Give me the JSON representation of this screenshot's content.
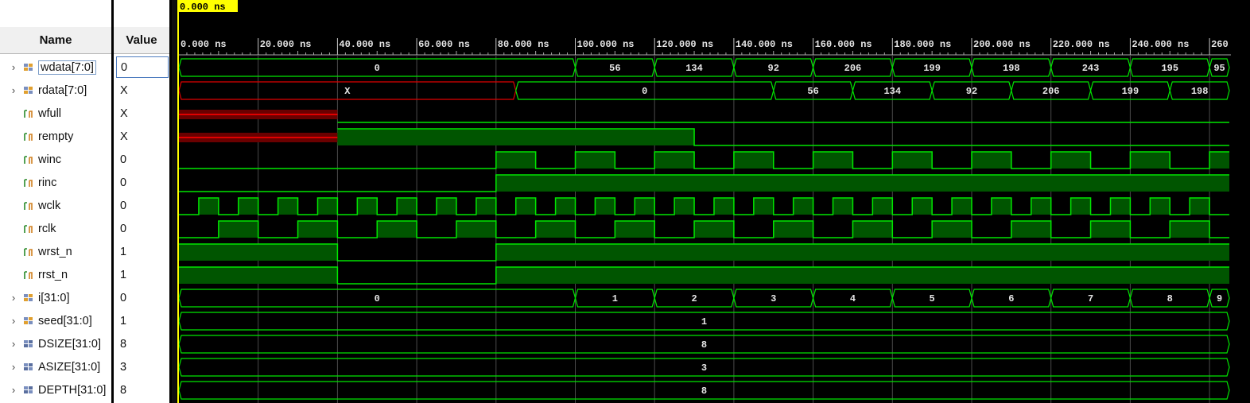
{
  "columns": {
    "name": "Name",
    "value": "Value"
  },
  "cursor_time": "0.000 ns",
  "timeline": {
    "ticks": [
      "0.000 ns",
      "20.000 ns",
      "40.000 ns",
      "60.000 ns",
      "80.000 ns",
      "100.000 ns",
      "120.000 ns",
      "140.000 ns",
      "160.000 ns",
      "180.000 ns",
      "200.000 ns",
      "220.000 ns",
      "240.000 ns",
      "260"
    ],
    "tick_times_ns": [
      0,
      20,
      40,
      60,
      80,
      100,
      120,
      140,
      160,
      180,
      200,
      220,
      240,
      260
    ]
  },
  "colors": {
    "wave": "#00e600",
    "fill": "#005500",
    "undefined": "#e00000",
    "undefined_fill": "#6a0000",
    "cursor": "#ffff00",
    "background": "#000000"
  },
  "signals": [
    {
      "name": "wdata[7:0]",
      "value": "0",
      "kind": "bus",
      "icon": "bus-icon",
      "expandable": true,
      "selected": true,
      "segments": [
        [
          0,
          100,
          "0"
        ],
        [
          100,
          120,
          "56"
        ],
        [
          120,
          140,
          "134"
        ],
        [
          140,
          160,
          "92"
        ],
        [
          160,
          180,
          "206"
        ],
        [
          180,
          200,
          "199"
        ],
        [
          200,
          220,
          "198"
        ],
        [
          220,
          240,
          "243"
        ],
        [
          240,
          260,
          "195"
        ],
        [
          260,
          265,
          "95"
        ]
      ]
    },
    {
      "name": "rdata[7:0]",
      "value": "X",
      "kind": "bus",
      "icon": "bus-icon",
      "expandable": true,
      "segments": [
        [
          0,
          85,
          "X",
          "x"
        ],
        [
          85,
          150,
          "0"
        ],
        [
          150,
          170,
          "56"
        ],
        [
          170,
          190,
          "134"
        ],
        [
          190,
          210,
          "92"
        ],
        [
          210,
          230,
          "206"
        ],
        [
          230,
          250,
          "199"
        ],
        [
          250,
          265,
          "198"
        ]
      ]
    },
    {
      "name": "wfull",
      "value": "X",
      "kind": "bit",
      "icon": "bit-icon",
      "segments": [
        [
          0,
          40,
          "x"
        ],
        [
          40,
          265,
          "0"
        ]
      ]
    },
    {
      "name": "rempty",
      "value": "X",
      "kind": "bit",
      "icon": "bit-icon",
      "segments": [
        [
          0,
          40,
          "x"
        ],
        [
          40,
          130,
          "1"
        ],
        [
          130,
          265,
          "0"
        ]
      ]
    },
    {
      "name": "winc",
      "value": "0",
      "kind": "bit",
      "icon": "bit-icon",
      "segments": [
        [
          0,
          80,
          "0"
        ],
        [
          80,
          90,
          "1"
        ],
        [
          90,
          100,
          "0"
        ],
        [
          100,
          110,
          "1"
        ],
        [
          110,
          120,
          "0"
        ],
        [
          120,
          130,
          "1"
        ],
        [
          130,
          140,
          "0"
        ],
        [
          140,
          150,
          "1"
        ],
        [
          150,
          160,
          "0"
        ],
        [
          160,
          170,
          "1"
        ],
        [
          170,
          180,
          "0"
        ],
        [
          180,
          190,
          "1"
        ],
        [
          190,
          200,
          "0"
        ],
        [
          200,
          210,
          "1"
        ],
        [
          210,
          220,
          "0"
        ],
        [
          220,
          230,
          "1"
        ],
        [
          230,
          240,
          "0"
        ],
        [
          240,
          250,
          "1"
        ],
        [
          250,
          260,
          "0"
        ],
        [
          260,
          265,
          "1"
        ]
      ]
    },
    {
      "name": "rinc",
      "value": "0",
      "kind": "bit",
      "icon": "bit-icon",
      "segments": [
        [
          0,
          80,
          "0"
        ],
        [
          80,
          265,
          "1"
        ]
      ]
    },
    {
      "name": "wclk",
      "value": "0",
      "kind": "clock",
      "icon": "bit-icon",
      "period_ns": 10,
      "high_offset_ns": 5
    },
    {
      "name": "rclk",
      "value": "0",
      "kind": "clock",
      "icon": "bit-icon",
      "period_ns": 20,
      "high_offset_ns": 10
    },
    {
      "name": "wrst_n",
      "value": "1",
      "kind": "bit",
      "icon": "bit-icon",
      "segments": [
        [
          0,
          40,
          "1"
        ],
        [
          40,
          80,
          "0"
        ],
        [
          80,
          265,
          "1"
        ]
      ]
    },
    {
      "name": "rrst_n",
      "value": "1",
      "kind": "bit",
      "icon": "bit-icon",
      "segments": [
        [
          0,
          40,
          "1"
        ],
        [
          40,
          80,
          "0"
        ],
        [
          80,
          265,
          "1"
        ]
      ]
    },
    {
      "name": "i[31:0]",
      "value": "0",
      "kind": "bus",
      "icon": "bus-icon",
      "expandable": true,
      "segments": [
        [
          0,
          100,
          "0"
        ],
        [
          100,
          120,
          "1"
        ],
        [
          120,
          140,
          "2"
        ],
        [
          140,
          160,
          "3"
        ],
        [
          160,
          180,
          "4"
        ],
        [
          180,
          200,
          "5"
        ],
        [
          200,
          220,
          "6"
        ],
        [
          220,
          240,
          "7"
        ],
        [
          240,
          260,
          "8"
        ],
        [
          260,
          265,
          "9"
        ]
      ]
    },
    {
      "name": "seed[31:0]",
      "value": "1",
      "kind": "bus",
      "icon": "bus-icon",
      "expandable": true,
      "segments": [
        [
          0,
          265,
          "1"
        ]
      ]
    },
    {
      "name": "DSIZE[31:0]",
      "value": "8",
      "kind": "bus",
      "icon": "param-icon",
      "expandable": true,
      "segments": [
        [
          0,
          265,
          "8"
        ]
      ]
    },
    {
      "name": "ASIZE[31:0]",
      "value": "3",
      "kind": "bus",
      "icon": "param-icon",
      "expandable": true,
      "segments": [
        [
          0,
          265,
          "3"
        ]
      ]
    },
    {
      "name": "DEPTH[31:0]",
      "value": "8",
      "kind": "bus",
      "icon": "param-icon",
      "expandable": true,
      "segments": [
        [
          0,
          265,
          "8"
        ]
      ]
    }
  ]
}
